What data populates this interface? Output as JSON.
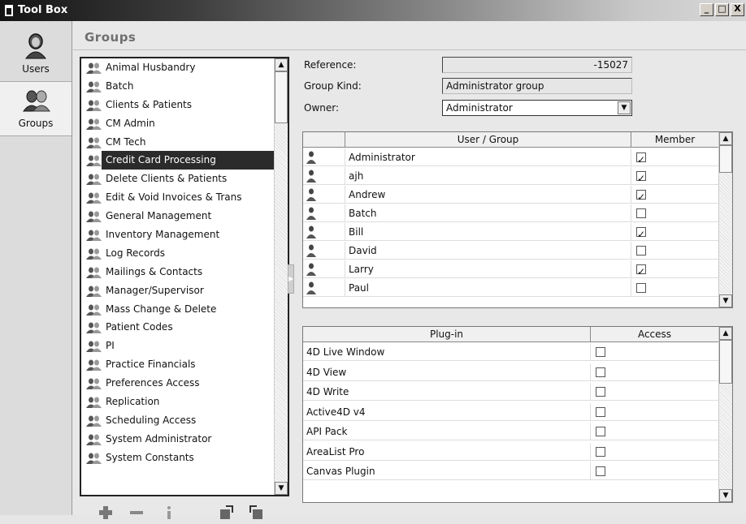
{
  "window": {
    "title": "Tool Box",
    "buttons": [
      "_",
      "□",
      "X"
    ]
  },
  "nav": [
    {
      "label": "Users",
      "icon": "user-icon"
    },
    {
      "label": "Groups",
      "icon": "groups-icon",
      "active": true
    }
  ],
  "page_title": "Groups",
  "groups": {
    "items": [
      "Animal Husbandry",
      "Batch",
      "Clients & Patients",
      "CM Admin",
      "CM Tech",
      "Credit Card Processing",
      "Delete Clients & Patients",
      "Edit & Void Invoices & Trans",
      "General Management",
      "Inventory Management",
      "Log Records",
      "Mailings & Contacts",
      "Manager/Supervisor",
      "Mass Change & Delete",
      "Patient Codes",
      "PI",
      "Practice Financials",
      "Preferences Access",
      "Replication",
      "Scheduling Access",
      "System Administrator",
      "System Constants"
    ],
    "selected": "Credit Card Processing"
  },
  "toolbar": [
    "add-icon",
    "remove-icon",
    "info-icon",
    "export-icon",
    "import-icon"
  ],
  "form": {
    "reference_label": "Reference:",
    "reference_value": "-15027",
    "kind_label": "Group Kind:",
    "kind_value": "Administrator group",
    "owner_label": "Owner:",
    "owner_value": "Administrator"
  },
  "user_table": {
    "headers": [
      "",
      "User / Group",
      "Member"
    ],
    "rows": [
      {
        "name": "Administrator",
        "member": true
      },
      {
        "name": "ajh",
        "member": true
      },
      {
        "name": "Andrew",
        "member": true
      },
      {
        "name": "Batch",
        "member": false
      },
      {
        "name": "Bill",
        "member": true
      },
      {
        "name": "David",
        "member": false
      },
      {
        "name": "Larry",
        "member": true
      },
      {
        "name": "Paul",
        "member": false
      }
    ]
  },
  "plugin_table": {
    "headers": [
      "Plug-in",
      "Access"
    ],
    "rows": [
      {
        "name": "4D Live Window",
        "access": false
      },
      {
        "name": "4D View",
        "access": false
      },
      {
        "name": "4D Write",
        "access": false
      },
      {
        "name": "Active4D v4",
        "access": false
      },
      {
        "name": "API Pack",
        "access": false
      },
      {
        "name": "AreaList Pro",
        "access": false
      },
      {
        "name": "Canvas Plugin",
        "access": false
      }
    ]
  }
}
